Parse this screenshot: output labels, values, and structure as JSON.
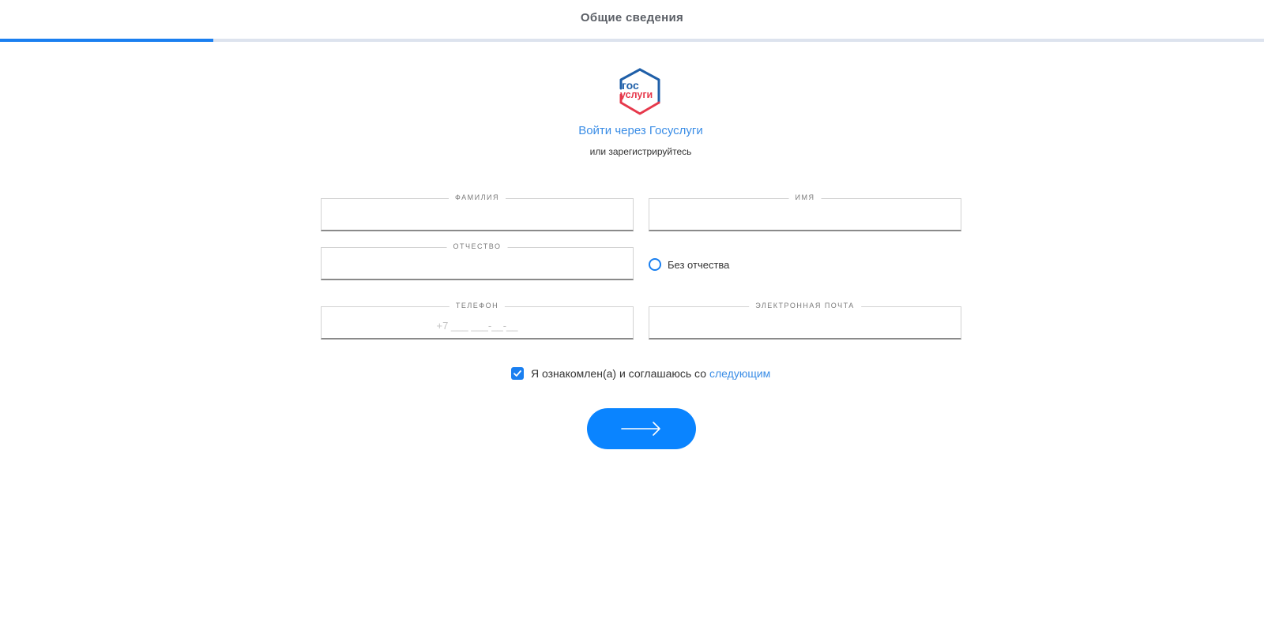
{
  "header": {
    "title": "Общие сведения",
    "progress_fraction": 0.169
  },
  "gosuslugi": {
    "logo_text_line1": "гос",
    "logo_text_line2": "услуги",
    "login_link": "Войти через Госуслуги",
    "subtext": "или зарегистрируйтесь"
  },
  "form": {
    "lastname": {
      "label": "ФАМИЛИЯ",
      "value": ""
    },
    "firstname": {
      "label": "ИМЯ",
      "value": ""
    },
    "middlename": {
      "label": "ОТЧЕСТВО",
      "value": ""
    },
    "no_middlename": {
      "label": "Без отчества",
      "checked": false
    },
    "phone": {
      "label": "ТЕЛЕФОН",
      "placeholder": "+7 ___ ___-__-__",
      "value": ""
    },
    "email": {
      "label": "ЭЛЕКТРОННАЯ ПОЧТА",
      "value": ""
    },
    "agreement": {
      "text": "Я ознакомлен(а) и соглашаюсь со",
      "link": "следующим",
      "checked": true
    },
    "submit": {
      "icon": "arrow-right-icon"
    }
  },
  "colors": {
    "accent": "#0a84ff",
    "link": "#3a8de6",
    "logo_blue": "#1f5fa8",
    "logo_red": "#e6384b"
  }
}
